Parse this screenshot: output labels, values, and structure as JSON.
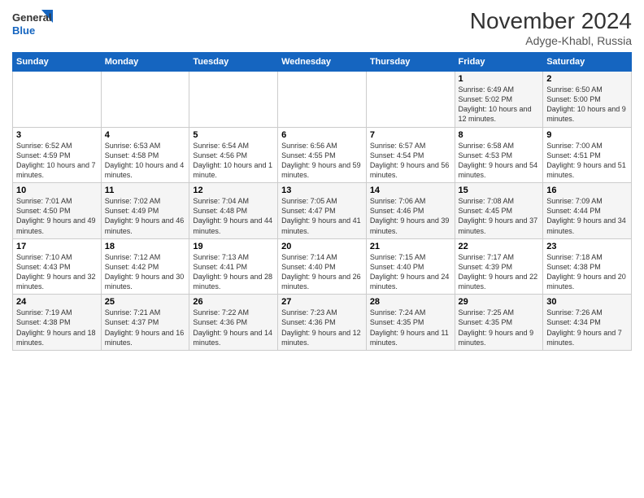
{
  "header": {
    "logo_line1": "General",
    "logo_line2": "Blue",
    "month_title": "November 2024",
    "location": "Adyge-Khabl, Russia"
  },
  "weekdays": [
    "Sunday",
    "Monday",
    "Tuesday",
    "Wednesday",
    "Thursday",
    "Friday",
    "Saturday"
  ],
  "weeks": [
    [
      {
        "day": "",
        "info": ""
      },
      {
        "day": "",
        "info": ""
      },
      {
        "day": "",
        "info": ""
      },
      {
        "day": "",
        "info": ""
      },
      {
        "day": "",
        "info": ""
      },
      {
        "day": "1",
        "info": "Sunrise: 6:49 AM\nSunset: 5:02 PM\nDaylight: 10 hours and 12 minutes."
      },
      {
        "day": "2",
        "info": "Sunrise: 6:50 AM\nSunset: 5:00 PM\nDaylight: 10 hours and 9 minutes."
      }
    ],
    [
      {
        "day": "3",
        "info": "Sunrise: 6:52 AM\nSunset: 4:59 PM\nDaylight: 10 hours and 7 minutes."
      },
      {
        "day": "4",
        "info": "Sunrise: 6:53 AM\nSunset: 4:58 PM\nDaylight: 10 hours and 4 minutes."
      },
      {
        "day": "5",
        "info": "Sunrise: 6:54 AM\nSunset: 4:56 PM\nDaylight: 10 hours and 1 minute."
      },
      {
        "day": "6",
        "info": "Sunrise: 6:56 AM\nSunset: 4:55 PM\nDaylight: 9 hours and 59 minutes."
      },
      {
        "day": "7",
        "info": "Sunrise: 6:57 AM\nSunset: 4:54 PM\nDaylight: 9 hours and 56 minutes."
      },
      {
        "day": "8",
        "info": "Sunrise: 6:58 AM\nSunset: 4:53 PM\nDaylight: 9 hours and 54 minutes."
      },
      {
        "day": "9",
        "info": "Sunrise: 7:00 AM\nSunset: 4:51 PM\nDaylight: 9 hours and 51 minutes."
      }
    ],
    [
      {
        "day": "10",
        "info": "Sunrise: 7:01 AM\nSunset: 4:50 PM\nDaylight: 9 hours and 49 minutes."
      },
      {
        "day": "11",
        "info": "Sunrise: 7:02 AM\nSunset: 4:49 PM\nDaylight: 9 hours and 46 minutes."
      },
      {
        "day": "12",
        "info": "Sunrise: 7:04 AM\nSunset: 4:48 PM\nDaylight: 9 hours and 44 minutes."
      },
      {
        "day": "13",
        "info": "Sunrise: 7:05 AM\nSunset: 4:47 PM\nDaylight: 9 hours and 41 minutes."
      },
      {
        "day": "14",
        "info": "Sunrise: 7:06 AM\nSunset: 4:46 PM\nDaylight: 9 hours and 39 minutes."
      },
      {
        "day": "15",
        "info": "Sunrise: 7:08 AM\nSunset: 4:45 PM\nDaylight: 9 hours and 37 minutes."
      },
      {
        "day": "16",
        "info": "Sunrise: 7:09 AM\nSunset: 4:44 PM\nDaylight: 9 hours and 34 minutes."
      }
    ],
    [
      {
        "day": "17",
        "info": "Sunrise: 7:10 AM\nSunset: 4:43 PM\nDaylight: 9 hours and 32 minutes."
      },
      {
        "day": "18",
        "info": "Sunrise: 7:12 AM\nSunset: 4:42 PM\nDaylight: 9 hours and 30 minutes."
      },
      {
        "day": "19",
        "info": "Sunrise: 7:13 AM\nSunset: 4:41 PM\nDaylight: 9 hours and 28 minutes."
      },
      {
        "day": "20",
        "info": "Sunrise: 7:14 AM\nSunset: 4:40 PM\nDaylight: 9 hours and 26 minutes."
      },
      {
        "day": "21",
        "info": "Sunrise: 7:15 AM\nSunset: 4:40 PM\nDaylight: 9 hours and 24 minutes."
      },
      {
        "day": "22",
        "info": "Sunrise: 7:17 AM\nSunset: 4:39 PM\nDaylight: 9 hours and 22 minutes."
      },
      {
        "day": "23",
        "info": "Sunrise: 7:18 AM\nSunset: 4:38 PM\nDaylight: 9 hours and 20 minutes."
      }
    ],
    [
      {
        "day": "24",
        "info": "Sunrise: 7:19 AM\nSunset: 4:38 PM\nDaylight: 9 hours and 18 minutes."
      },
      {
        "day": "25",
        "info": "Sunrise: 7:21 AM\nSunset: 4:37 PM\nDaylight: 9 hours and 16 minutes."
      },
      {
        "day": "26",
        "info": "Sunrise: 7:22 AM\nSunset: 4:36 PM\nDaylight: 9 hours and 14 minutes."
      },
      {
        "day": "27",
        "info": "Sunrise: 7:23 AM\nSunset: 4:36 PM\nDaylight: 9 hours and 12 minutes."
      },
      {
        "day": "28",
        "info": "Sunrise: 7:24 AM\nSunset: 4:35 PM\nDaylight: 9 hours and 11 minutes."
      },
      {
        "day": "29",
        "info": "Sunrise: 7:25 AM\nSunset: 4:35 PM\nDaylight: 9 hours and 9 minutes."
      },
      {
        "day": "30",
        "info": "Sunrise: 7:26 AM\nSunset: 4:34 PM\nDaylight: 9 hours and 7 minutes."
      }
    ]
  ]
}
